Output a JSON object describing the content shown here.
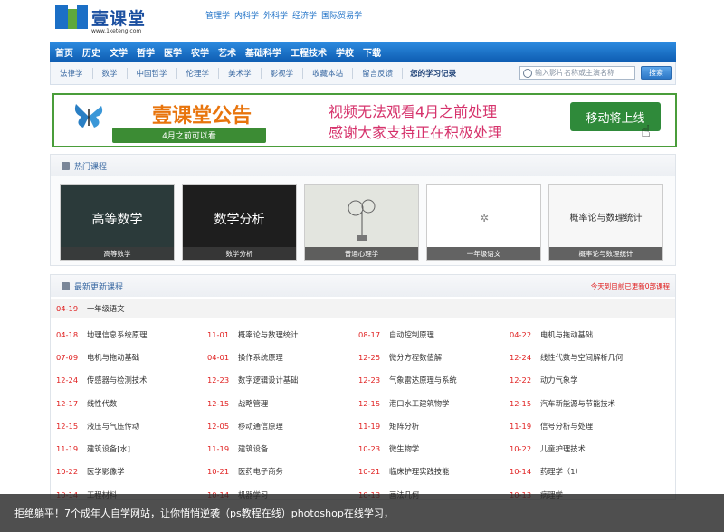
{
  "logo": {
    "text": "壹课堂",
    "url": "www.1keteng.com"
  },
  "top_links": [
    "管理学",
    "内科学",
    "外科学",
    "经济学",
    "国际贸易学"
  ],
  "nav_main": [
    "首页",
    "历史",
    "文学",
    "哲学",
    "医学",
    "农学",
    "艺术",
    "基础科学",
    "工程技术",
    "学校",
    "下载"
  ],
  "nav_sub": [
    "法律学",
    "数学",
    "中国哲学",
    "伦理学",
    "美术学",
    "影视学",
    "收藏本站",
    "留言反馈"
  ],
  "my_study": "您的学习记录",
  "search": {
    "placeholder": "输入影片名称或主演名称",
    "button": "搜索"
  },
  "banner": {
    "title": "壹课堂公告",
    "subtitle": "4月之前可以看",
    "msg1": "视频无法观看4月之前处理",
    "msg2": "感谢大家支持正在积极处理",
    "button": "移动将上线"
  },
  "hot": {
    "title": "热门课程",
    "cards": [
      {
        "big": "高等数学",
        "caption": "高等数学"
      },
      {
        "big": "数学分析",
        "caption": "数学分析"
      },
      {
        "big": "",
        "caption": "普通心理学"
      },
      {
        "big": "",
        "caption": "一年级语文"
      },
      {
        "big": "概率论与数理统计",
        "caption": "概率论与数理统计"
      }
    ]
  },
  "updates": {
    "title": "最新更新课程",
    "today": "今天到目前已更新0部课程",
    "first": {
      "date": "04-19",
      "title": "一年级语文"
    },
    "rows": [
      [
        {
          "date": "04-18",
          "title": "地理信息系统原理"
        },
        {
          "date": "11-01",
          "title": "概率论与数理统计"
        },
        {
          "date": "08-17",
          "title": "自动控制原理"
        },
        {
          "date": "04-22",
          "title": "电机与拖动基础"
        }
      ],
      [
        {
          "date": "07-09",
          "title": "电机与拖动基础"
        },
        {
          "date": "04-01",
          "title": "操作系统原理"
        },
        {
          "date": "12-25",
          "title": "微分方程数值解"
        },
        {
          "date": "12-24",
          "title": "线性代数与空间解析几何"
        }
      ],
      [
        {
          "date": "12-24",
          "title": "传感器与检测技术"
        },
        {
          "date": "12-23",
          "title": "数字逻辑设计基础"
        },
        {
          "date": "12-23",
          "title": "气象雷达原理与系统"
        },
        {
          "date": "12-22",
          "title": "动力气象学"
        }
      ],
      [
        {
          "date": "12-17",
          "title": "线性代数"
        },
        {
          "date": "12-15",
          "title": "战略管理"
        },
        {
          "date": "12-15",
          "title": "港口水工建筑物学"
        },
        {
          "date": "12-15",
          "title": "汽车新能源与节能技术"
        }
      ],
      [
        {
          "date": "12-15",
          "title": "液压与气压传动"
        },
        {
          "date": "12-05",
          "title": "移动通信原理"
        },
        {
          "date": "11-19",
          "title": "矩阵分析"
        },
        {
          "date": "11-19",
          "title": "信号分析与处理"
        }
      ],
      [
        {
          "date": "11-19",
          "title": "建筑设备[水]"
        },
        {
          "date": "11-19",
          "title": "建筑设备"
        },
        {
          "date": "10-23",
          "title": "微生物学"
        },
        {
          "date": "10-22",
          "title": "儿童护理技术"
        }
      ],
      [
        {
          "date": "10-22",
          "title": "医学影像学"
        },
        {
          "date": "10-21",
          "title": "医药电子商务"
        },
        {
          "date": "10-21",
          "title": "临床护理实践技能"
        },
        {
          "date": "10-14",
          "title": "药理学（1）"
        }
      ],
      [
        {
          "date": "10-14",
          "title": "工程材料"
        },
        {
          "date": "10-14",
          "title": "机器学习"
        },
        {
          "date": "10-13",
          "title": "画法几何"
        },
        {
          "date": "10-13",
          "title": "病理学"
        }
      ]
    ]
  },
  "bottom_caption": "拒绝躺平！7个成年人自学网站，让你悄悄逆袭（ps教程在线）photoshop在线学习，"
}
